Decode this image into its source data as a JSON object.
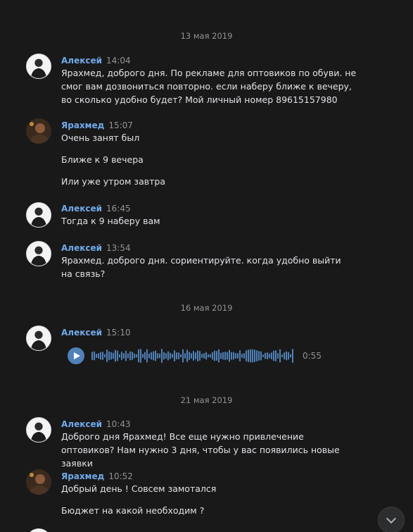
{
  "dates": [
    "13 мая 2019",
    "16 мая 2019",
    "21 мая 2019"
  ],
  "messages": [
    {
      "author": "Алексей",
      "time": "14:04",
      "text": [
        "Ярахмед, доброго дня. По рекламе для оптовиков по обуви. не смог вам дозвониться повторно. если наберу ближе к вечеру, во сколько удобно будет? Мой личный номер 89615157980"
      ]
    },
    {
      "author": "Ярахмед",
      "time": "15:07",
      "text": [
        "Очень занят был",
        "Ближе к 9 вечера",
        "Или уже утром завтра"
      ]
    },
    {
      "author": "Алексей",
      "time": "16:45",
      "text": [
        "Тогда к 9 наберу вам"
      ]
    },
    {
      "author": "Алексей",
      "time": "13:54",
      "text": [
        "Ярахмед. доброго дня. сориентируйте. когда удобно выйти на связь?"
      ]
    },
    {
      "author": "Алексей",
      "time": "15:10",
      "voice": {
        "duration": "0:55"
      }
    },
    {
      "author": "Алексей",
      "time": "10:43",
      "text": [
        "Доброго дня Ярахмед! Все еще нужно привлечение оптовиков? Нам нужно 3 дня, чтобы у вас появились новые заявки"
      ]
    },
    {
      "author": "Ярахмед",
      "time": "10:52",
      "text": [
        "Добрый день ! Совсем замотался",
        "Бюджет на какой необходим ?"
      ]
    }
  ],
  "colors": {
    "background": "#19191a",
    "author_name": "#71aaeb",
    "meta": "#939393",
    "text": "#e1e3e6",
    "accent": "#5181b8"
  },
  "icons": {
    "play": "play-icon",
    "scroll_down": "chevron-down-icon"
  }
}
